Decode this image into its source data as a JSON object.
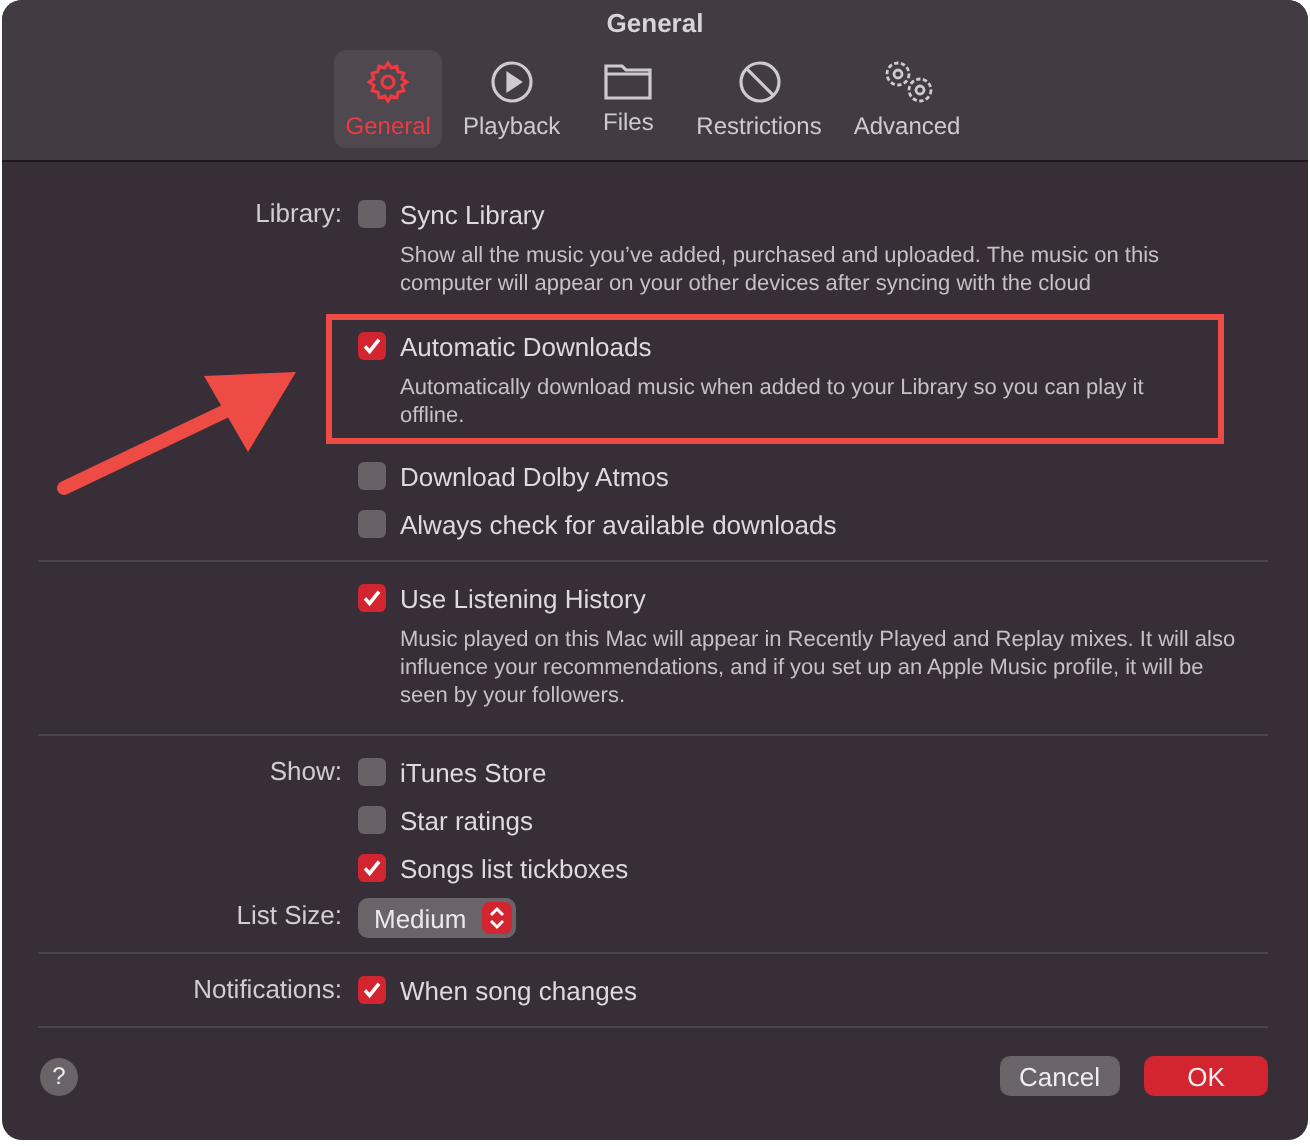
{
  "window": {
    "title": "General"
  },
  "tabs": [
    {
      "label": "General",
      "selected": true
    },
    {
      "label": "Playback",
      "selected": false
    },
    {
      "label": "Files",
      "selected": false
    },
    {
      "label": "Restrictions",
      "selected": false
    },
    {
      "label": "Advanced",
      "selected": false
    }
  ],
  "sections": [
    {
      "rows": [
        {
          "label": "Library:",
          "kind": "checkbox",
          "text": "Sync Library",
          "checked": false,
          "highlighted": false,
          "description": "Show all the music you’ve added, purchased and uploaded. The music on this computer will appear on your other devices after syncing with the cloud"
        },
        {
          "kind": "checkbox",
          "text": "Automatic Downloads",
          "checked": true,
          "highlighted": true,
          "description": "Automatically download music when added to your Library so you can play it offline."
        },
        {
          "kind": "checkbox",
          "text": "Download Dolby Atmos",
          "checked": false,
          "highlighted": false
        },
        {
          "kind": "checkbox",
          "text": "Always check for available downloads",
          "checked": false,
          "highlighted": false
        }
      ]
    },
    {
      "rows": [
        {
          "kind": "checkbox",
          "text": "Use Listening History",
          "checked": true,
          "highlighted": false,
          "description": "Music played on this Mac will appear in Recently Played and Replay mixes. It will also influence your recommendations, and if you set up an Apple Music profile, it will be seen by your followers."
        }
      ]
    },
    {
      "rows": [
        {
          "label": "Show:",
          "kind": "checkbox",
          "text": "iTunes Store",
          "checked": false,
          "highlighted": false
        },
        {
          "kind": "checkbox",
          "text": "Star ratings",
          "checked": false,
          "highlighted": false
        },
        {
          "kind": "checkbox",
          "text": "Songs list tickboxes",
          "checked": true,
          "highlighted": false
        },
        {
          "label": "List Size:",
          "kind": "popup",
          "value": "Medium"
        }
      ]
    },
    {
      "rows": [
        {
          "label": "Notifications:",
          "kind": "checkbox",
          "text": "When song changes",
          "checked": true,
          "highlighted": false
        }
      ]
    }
  ],
  "footer": [
    {
      "kind": "help",
      "label": "?"
    },
    {
      "kind": "cancel",
      "label": "Cancel"
    },
    {
      "kind": "default",
      "label": "OK"
    }
  ]
}
